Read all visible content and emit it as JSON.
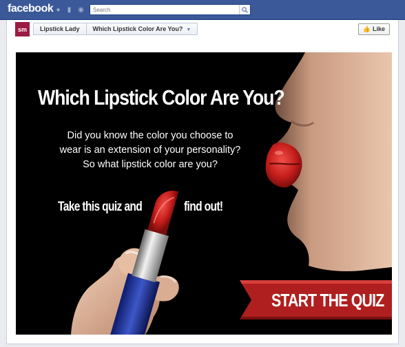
{
  "topbar": {
    "logo": "facebook",
    "search_placeholder": "Search",
    "icons": [
      "friends-icon",
      "messages-icon",
      "notifications-icon",
      "search-icon"
    ]
  },
  "appbar": {
    "avatar_text": "sm",
    "crumb_page": "Lipstick Lady",
    "crumb_tab": "Which Lipstick Color Are You?",
    "like_label": "Like"
  },
  "quiz": {
    "title": "Which Lipstick Color Are You?",
    "desc_line1": "Did you know the color you choose to",
    "desc_line2": "wear is an extension of your personality?",
    "desc_line3": "So what lipstick color are you?",
    "take_text": "Take this quiz and",
    "find_text": "find out!",
    "cta": "START THE QUIZ"
  },
  "colors": {
    "fb_blue": "#3b5998",
    "lip_red": "#c9211f",
    "banner_red": "#b01f1f"
  }
}
